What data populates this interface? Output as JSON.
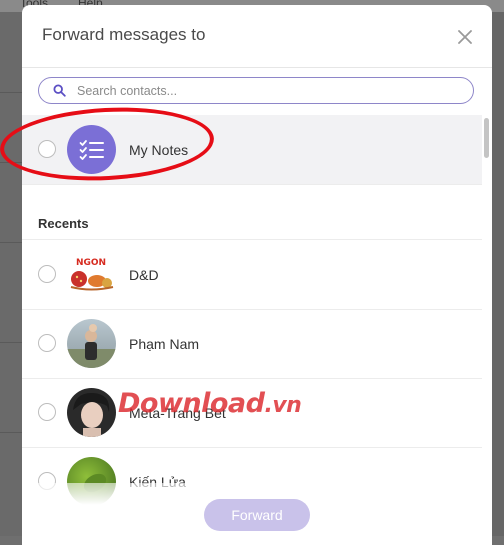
{
  "background": {
    "menu_items": [
      "Tools",
      "Help"
    ]
  },
  "dialog": {
    "title": "Forward messages to",
    "close_icon": "close-icon"
  },
  "search": {
    "placeholder": "Search contacts...",
    "value": ""
  },
  "pinned": {
    "label": "My Notes",
    "icon": "checklist-icon",
    "icon_bg": "#7b6fd6"
  },
  "recents": {
    "heading": "Recents",
    "contacts": [
      {
        "name": "D&D",
        "avatar_text": "NGON"
      },
      {
        "name": "Phạm Nam"
      },
      {
        "name": "Meta-Trang Bet"
      },
      {
        "name": "Kiến Lửa"
      }
    ]
  },
  "footer": {
    "forward_label": "Forward"
  },
  "watermark": {
    "text": "Download",
    "suffix": ".vn"
  },
  "colors": {
    "accent": "#7b6fd6",
    "button_disabled": "#c9c2ea",
    "annotation": "#e60d16"
  }
}
